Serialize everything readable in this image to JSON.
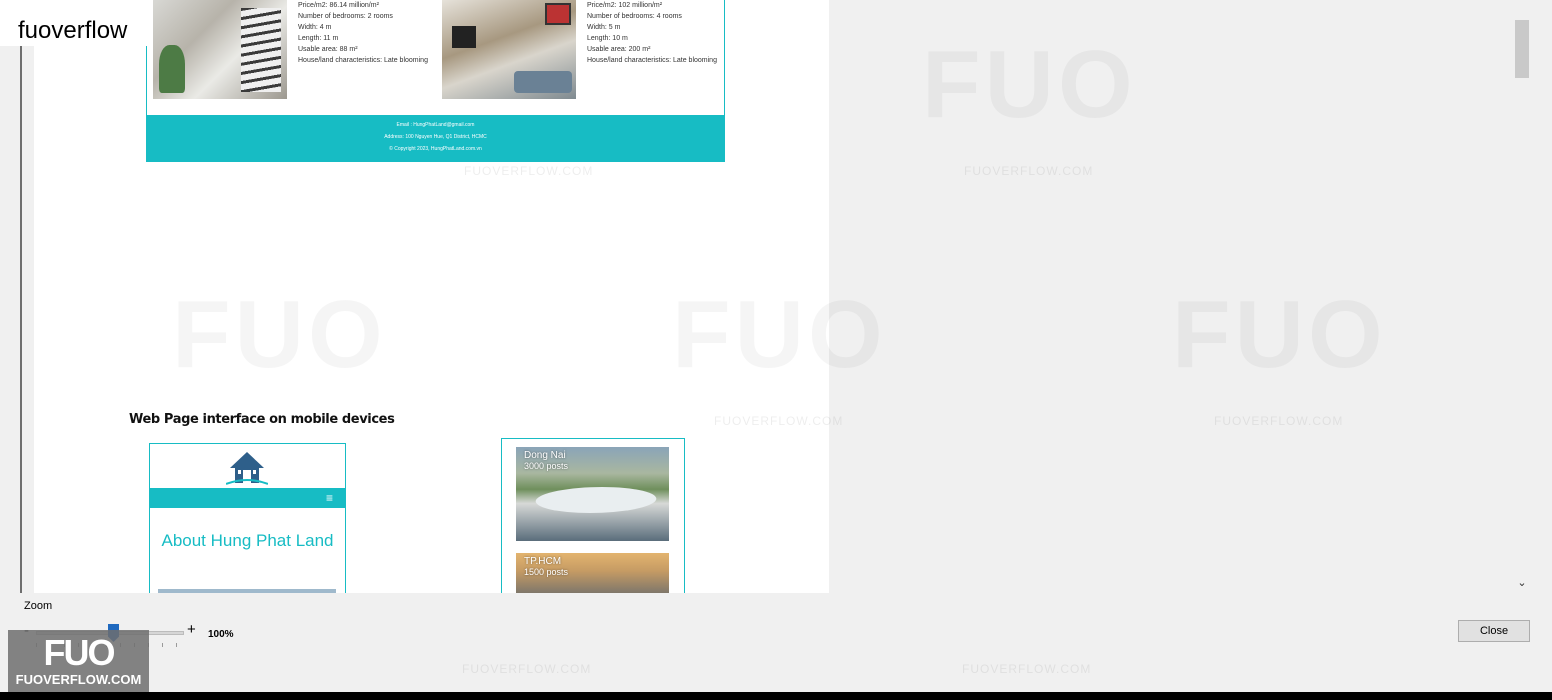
{
  "app_label": "fuoverflow",
  "listing_left": {
    "lines": [
      "Price/m2: 86.14 million/m²",
      "Number of bedrooms: 2 rooms",
      "Width: 4 m",
      "Length: 11 m",
      "Usable area: 88 m²",
      "House/land characteristics: Late blooming"
    ]
  },
  "listing_right": {
    "lines": [
      "Price/m2: 102 million/m²",
      "Number of bedrooms: 4 rooms",
      "Width: 5 m",
      "Length: 10 m",
      "Usable area: 200 m²",
      "House/land characteristics: Late blooming"
    ]
  },
  "footer": {
    "email": "Email : HungPhatLand@gmail.com",
    "address": "Address: 100 Nguyen Hue, Q1 District, HCMC",
    "copyright": "© Copyright 2023, HungPhatLand.com.vn"
  },
  "mobile_section": {
    "title": "Web Page interface on mobile devices",
    "phone_title": "About Hung Phat Land",
    "cards": [
      {
        "name": "Dong Nai",
        "posts": "3000 posts"
      },
      {
        "name": "TP.HCM",
        "posts": "1500 posts"
      }
    ]
  },
  "watermark": {
    "domain": "FUOVERFLOW.COM",
    "logo": "FUO"
  },
  "zoom": {
    "label": "Zoom",
    "minus": "-",
    "plus": "+",
    "value": "100%",
    "level_percent": 100
  },
  "buttons": {
    "close": "Close"
  },
  "badge": {
    "logo": "FUO",
    "domain": "FUOVERFLOW.COM"
  },
  "colors": {
    "accent": "#17bcc4",
    "slider_thumb": "#1f69bf"
  }
}
